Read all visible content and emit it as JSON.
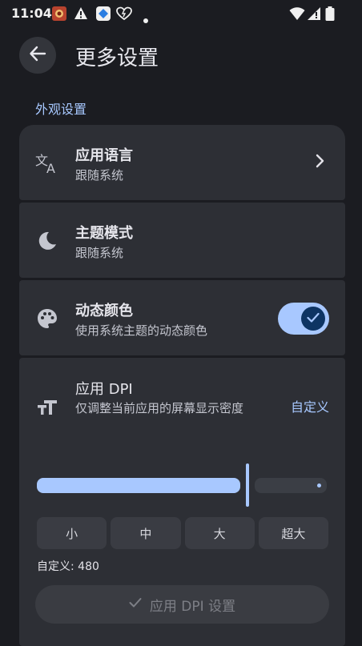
{
  "status_bar": {
    "time": "11:04",
    "icons": [
      "app-notification-icon",
      "warning-icon",
      "app-icon-blue",
      "heart-icon",
      "dot-icon",
      "wifi-icon",
      "signal-icon",
      "battery-icon"
    ]
  },
  "header": {
    "title": "更多设置",
    "back_icon": "arrow-left-icon"
  },
  "section": {
    "title": "外观设置"
  },
  "settings": {
    "language": {
      "title": "应用语言",
      "subtitle": "跟随系统",
      "icon": "translate-icon"
    },
    "theme": {
      "title": "主题模式",
      "subtitle": "跟随系统",
      "icon": "moon-icon"
    },
    "dynamic_color": {
      "title": "动态颜色",
      "subtitle": "使用系统主题的动态颜色",
      "icon": "palette-icon",
      "enabled": true
    },
    "dpi": {
      "title": "应用 DPI",
      "subtitle": "仅调整当前应用的屏幕显示密度",
      "action": "自定义",
      "icon": "text-size-icon",
      "slider_level_fraction": 0.71,
      "presets": [
        "小",
        "中",
        "大",
        "超大"
      ],
      "custom_label": "自定义: 480",
      "apply_label": "应用 DPI 设置"
    }
  },
  "colors": {
    "background": "#1b1c21",
    "card": "#2d2f35",
    "accent": "#a8c8ff",
    "accent_dark": "#0d3463"
  }
}
